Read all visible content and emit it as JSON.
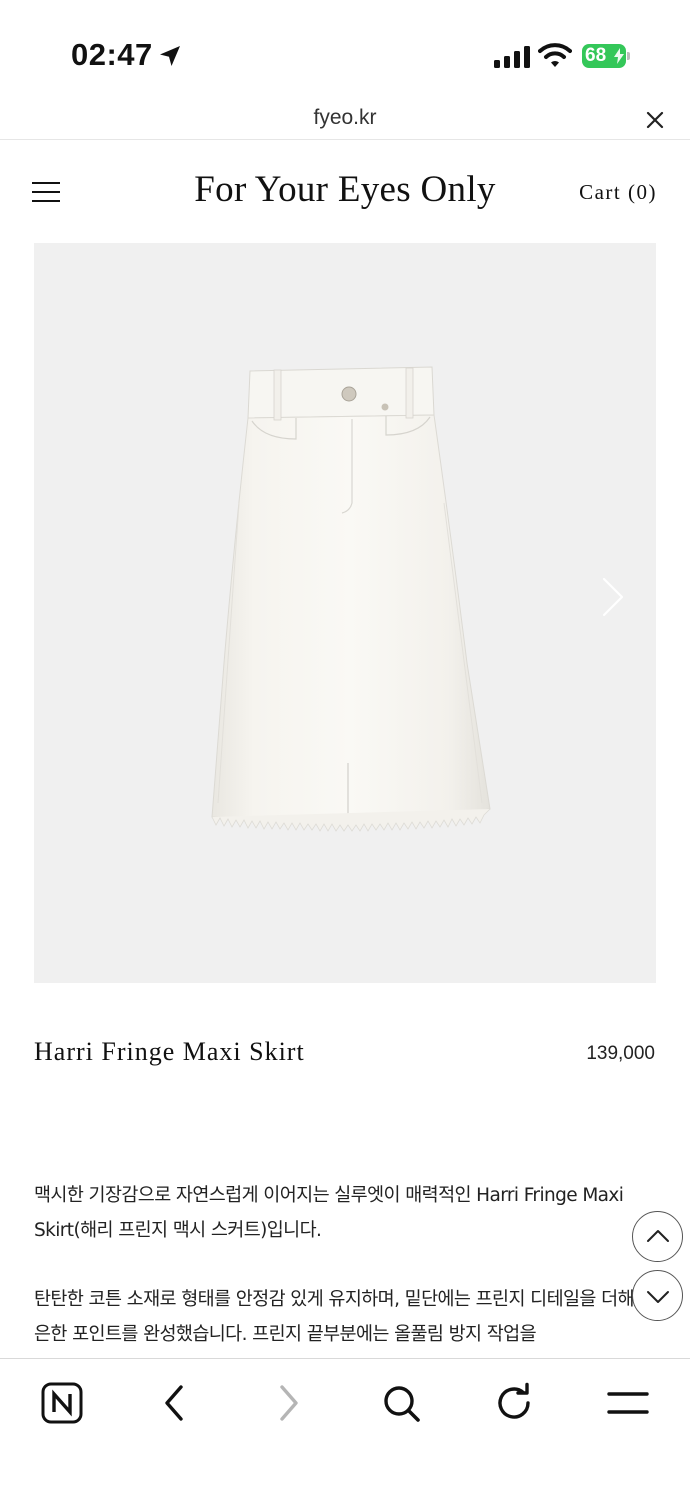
{
  "status_bar": {
    "time": "02:47",
    "battery": "68",
    "icons": [
      "location-arrow-icon",
      "signal-icon",
      "wifi-icon",
      "battery-charging-icon"
    ]
  },
  "browser": {
    "url": "fyeo.kr",
    "toolbar_icons": [
      "naver-icon",
      "back-icon",
      "forward-icon",
      "search-icon",
      "reload-icon",
      "menu-icon"
    ]
  },
  "header": {
    "site_title": "For Your Eyes Only",
    "cart_label": "Cart (0)"
  },
  "product": {
    "name": "Harri Fringe Maxi Skirt",
    "price": "139,000",
    "image": "white-denim-maxi-skirt-photo"
  },
  "description": {
    "paragraph_1": "맥시한 기장감으로 자연스럽게 이어지는 실루엣이 매력적인 Harri Fringe Maxi Skirt(해리 프린지 맥시 스커트)입니다.",
    "paragraph_2": "탄탄한 코튼 소재로 형태를 안정감 있게 유지하며, 밑단에는 프린지 디테일을 더해 은은한 포인트를 완성했습니다. 프린지 끝부분에는 올풀림 방지 작업을"
  },
  "colors": {
    "battery": "#34c759",
    "image_bg": "#f0f0f0",
    "skirt": "#f5f3ee"
  }
}
